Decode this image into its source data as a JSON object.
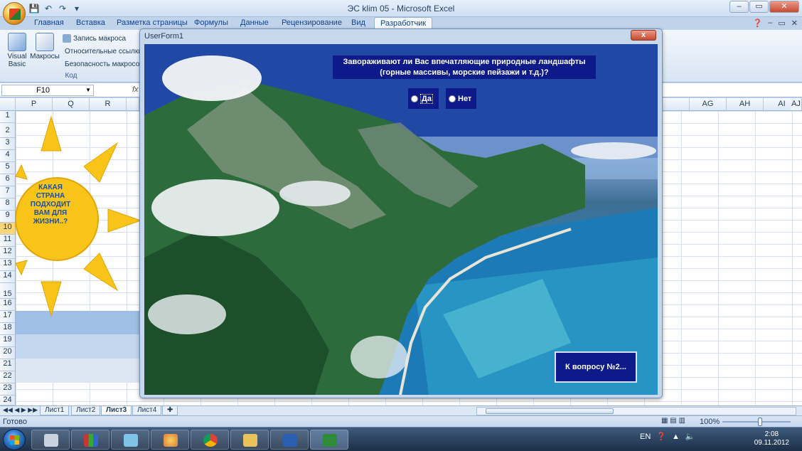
{
  "window": {
    "title": "ЭС klim 05 - Microsoft Excel",
    "minimize": "–",
    "restore": "▭",
    "close": "✕"
  },
  "ribbon_tabs": [
    "Главная",
    "Вставка",
    "Разметка страницы",
    "Формулы",
    "Данные",
    "Рецензирование",
    "Вид",
    "Разработчик"
  ],
  "active_tab": "Разработчик",
  "ribbon": {
    "visual_basic": "Visual Basic",
    "macros": "Макросы",
    "record_macro": "Запись макроса",
    "relative_refs": "Относительные ссылки",
    "macro_security": "Безопасность макросов",
    "group_label": "Код"
  },
  "formula_bar": {
    "name_box": "F10",
    "fx": "fx"
  },
  "columns_left": [
    "P",
    "Q",
    "R"
  ],
  "columns_right": [
    "AG",
    "AH",
    "AI",
    "AJ"
  ],
  "rows": [
    "1",
    "2",
    "3",
    "4",
    "5",
    "6",
    "7",
    "8",
    "9",
    "10",
    "11",
    "12",
    "13",
    "14",
    "15",
    "16",
    "17",
    "18",
    "19",
    "20",
    "21",
    "22",
    "23",
    "24"
  ],
  "sun_text": "КАКАЯ СТРАНА ПОДХОДИТ ВАМ ДЛЯ ЖИЗНИ..?",
  "sheet_tabs": [
    "Лист1",
    "Лист2",
    "Лист3",
    "Лист4"
  ],
  "active_sheet": "Лист3",
  "status": {
    "ready": "Готово",
    "zoom": "100%"
  },
  "userform": {
    "title": "UserForm1",
    "close": "x",
    "question_line1": "Завораживают ли Вас впечатляющие природные ландшафты",
    "question_line2": "(горные массивы, морские пейзажи и т.д.)?",
    "option_yes": "Да",
    "option_no": "Нет",
    "next_button": "К вопросу №2..."
  },
  "taskbar": {
    "lang": "EN",
    "time": "2:08",
    "date": "09.11.2012"
  },
  "colors": {
    "form_panel": "#0e1a8a",
    "sun": "#f8c418",
    "sun_text": "#1b4fa5"
  }
}
